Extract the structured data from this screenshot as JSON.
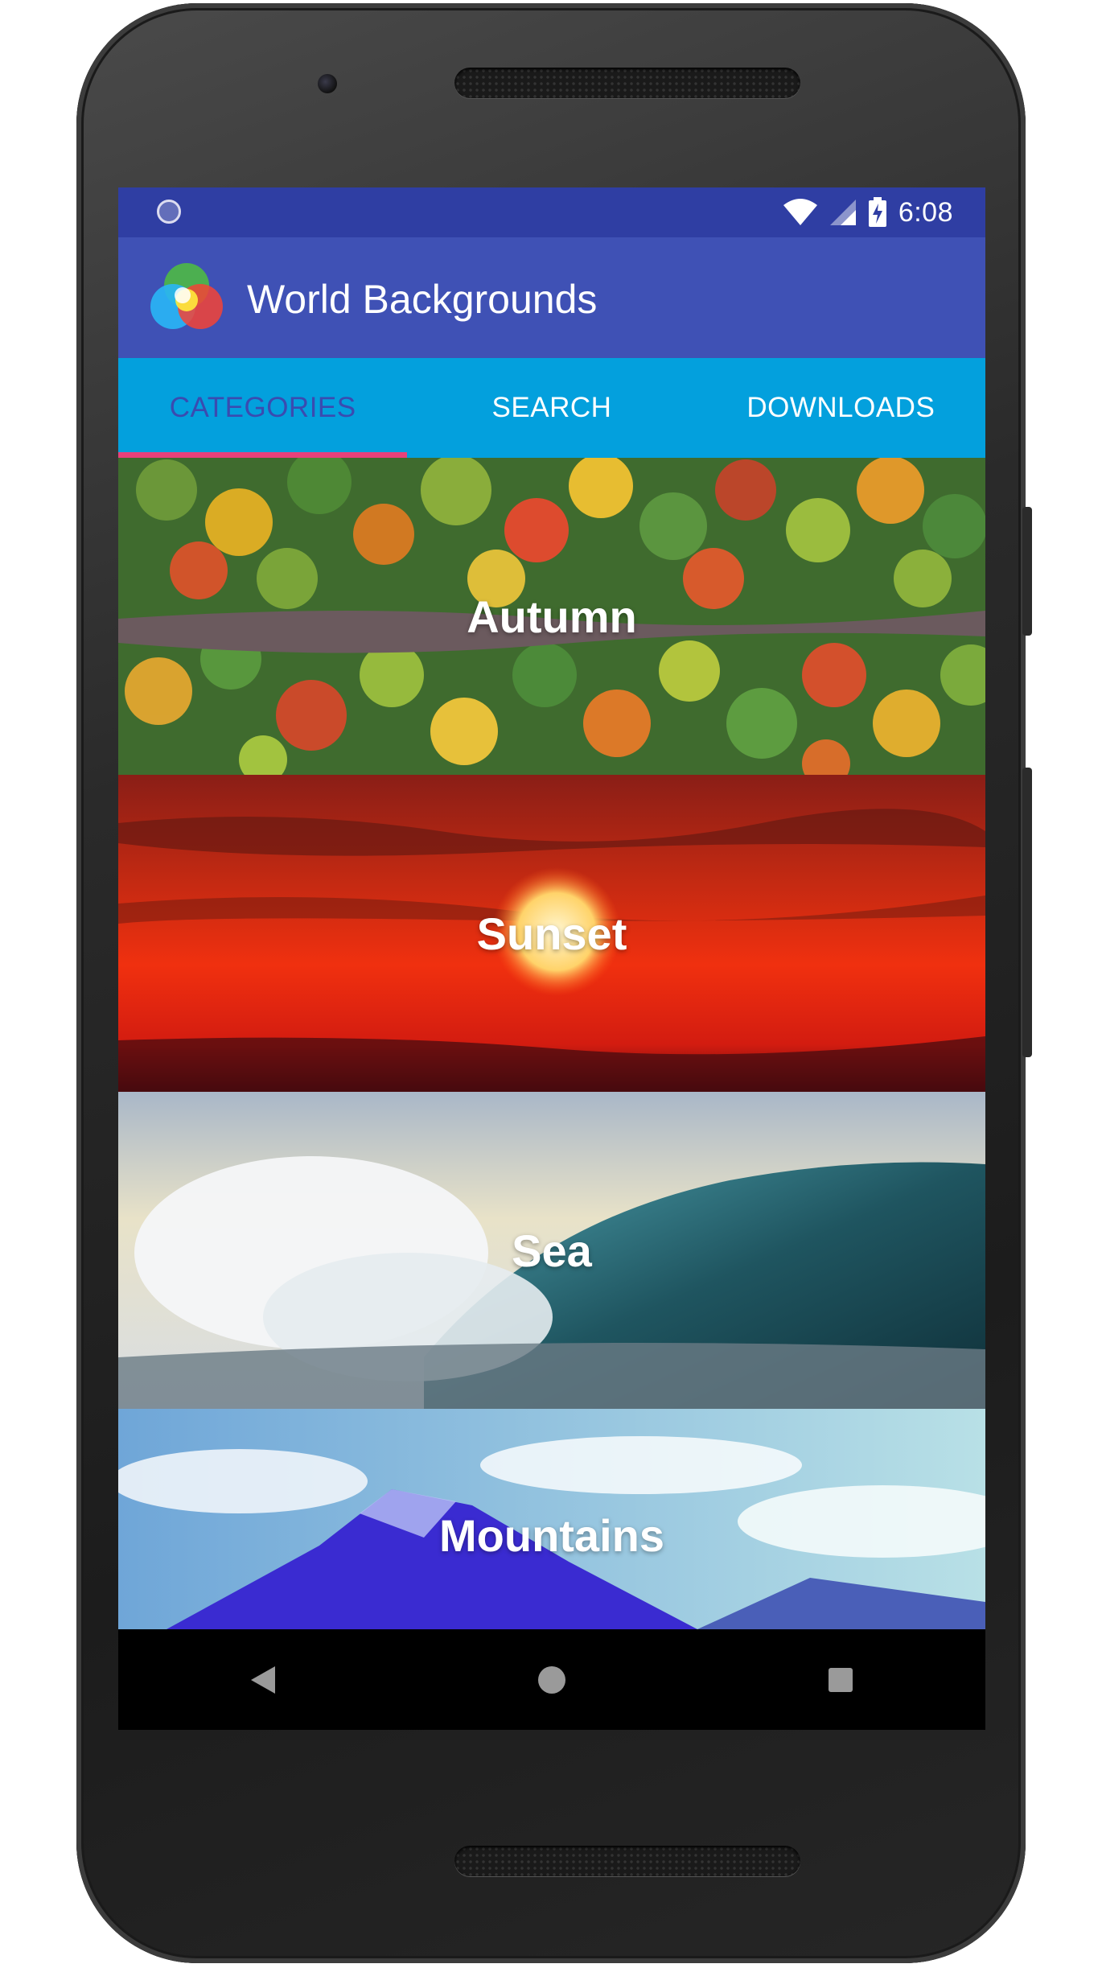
{
  "status_bar": {
    "time": "6:08",
    "icons": [
      "notification-dot-icon",
      "wifi-icon",
      "cell-signal-icon",
      "battery-charging-icon"
    ]
  },
  "app_bar": {
    "title": "World Backgrounds",
    "logo_icon": "app-logo-icon",
    "color": "#3f51b5"
  },
  "tabs": [
    {
      "label": "CATEGORIES",
      "active": true
    },
    {
      "label": "SEARCH",
      "active": false
    },
    {
      "label": "DOWNLOADS",
      "active": false
    }
  ],
  "tab_bar_color": "#03a0dd",
  "tab_indicator_color": "#e8417a",
  "categories": [
    {
      "label": "Autumn"
    },
    {
      "label": "Sunset"
    },
    {
      "label": "Sea"
    },
    {
      "label": "Mountains"
    }
  ],
  "nav_bar": {
    "buttons": [
      "back-icon",
      "home-icon",
      "recents-icon"
    ]
  }
}
